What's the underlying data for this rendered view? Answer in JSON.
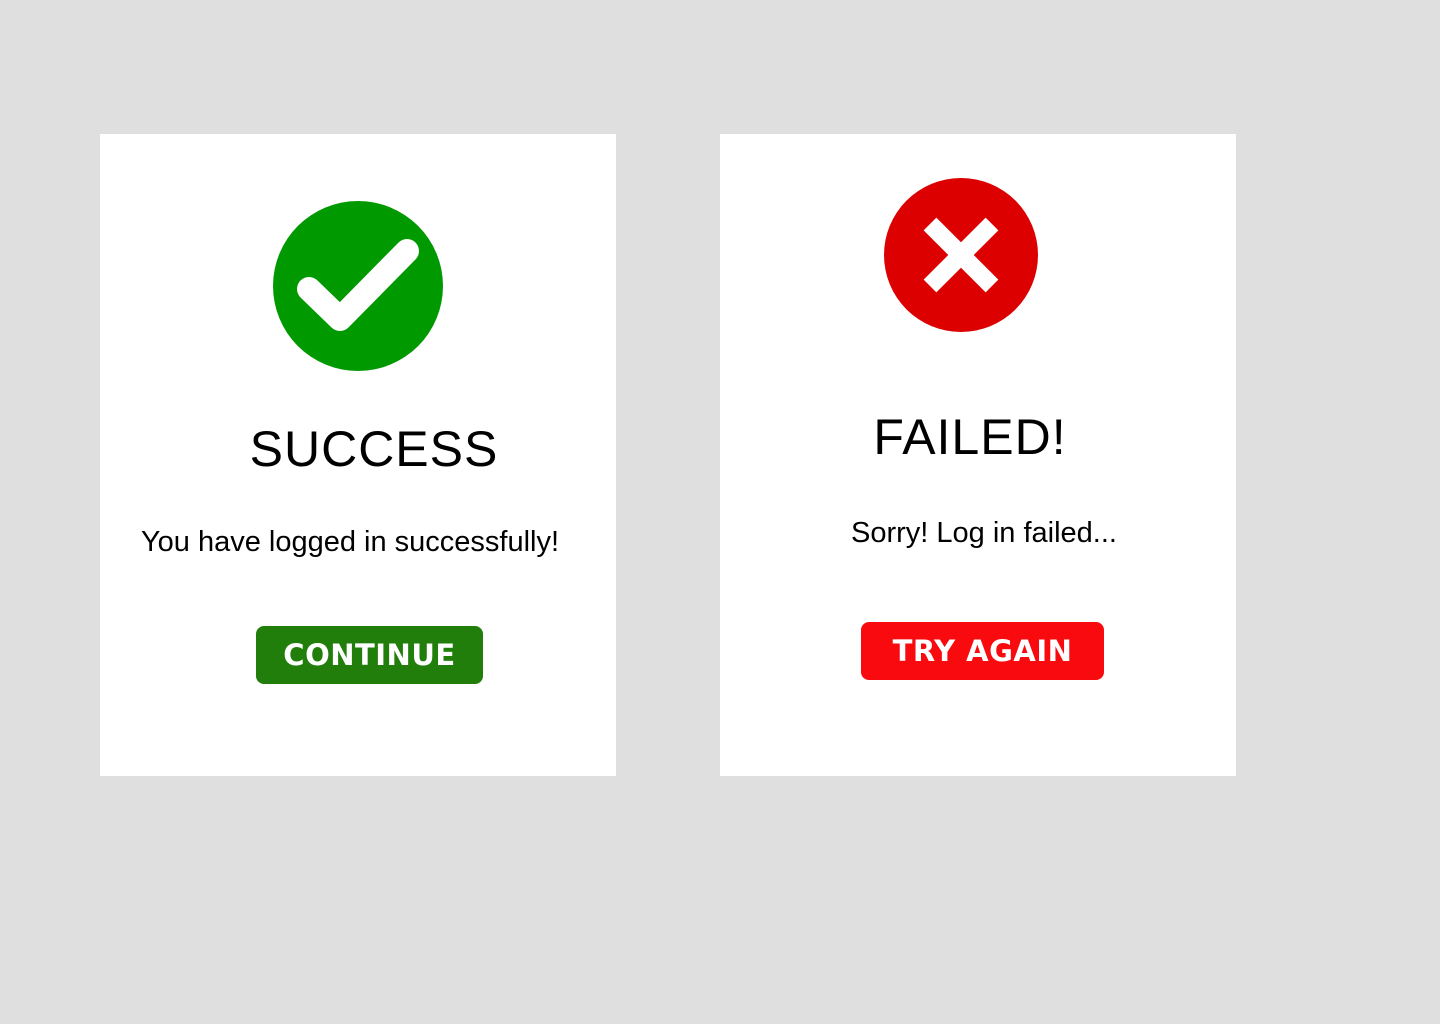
{
  "success_card": {
    "icon": "check-circle-icon",
    "icon_color": "#009900",
    "title": "SUCCESS",
    "message": "You have logged in successfully!",
    "button_label": "CONTINUE",
    "button_color": "#217e0b"
  },
  "failed_card": {
    "icon": "x-circle-icon",
    "icon_color": "#dd0000",
    "title": "FAILED!",
    "message": "Sorry! Log in failed...",
    "button_label": "TRY AGAIN",
    "button_color": "#f90a0f"
  },
  "background_color": "#dfdfdf"
}
